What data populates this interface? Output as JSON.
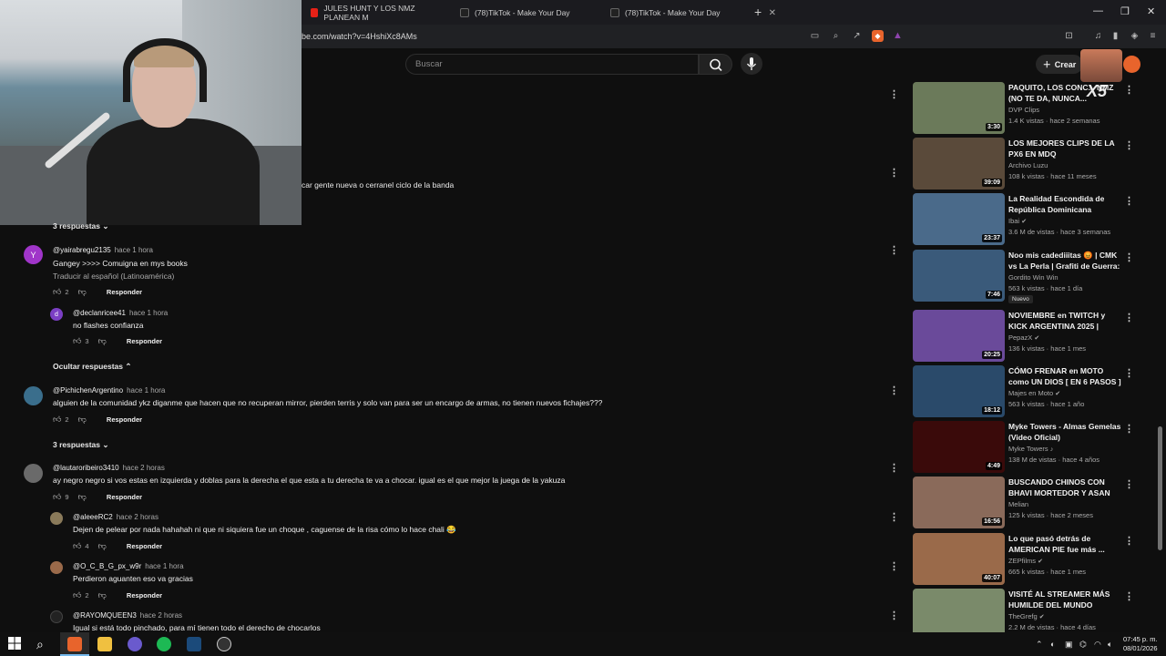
{
  "browser": {
    "tabs": [
      {
        "label": "JULES HUNT Y LOS NMZ PLANEAN M",
        "kind": "youtube"
      },
      {
        "label": "(78)TikTok - Make Your Day",
        "kind": "tiktok"
      },
      {
        "label": "(78)TikTok - Make Your Day",
        "kind": "tiktok"
      }
    ],
    "new_tab": "+",
    "url": "be.com/watch?v=4HshiXc8AMs"
  },
  "masthead": {
    "search_placeholder": "Buscar",
    "create_label": "Crear"
  },
  "overlay": {
    "multiplier": "X5"
  },
  "comments": {
    "partial_text": "car gente nueva o cerranel ciclo de la banda",
    "toggles": {
      "replies_1": "3 respuestas",
      "hide_replies": "Ocultar respuestas",
      "replies_2": "3 respuestas"
    },
    "reply_label": "Responder",
    "items": [
      {
        "user": "@yairabregu2135",
        "time": "hace 1 hora",
        "text": "Gangey >>>> Comuigna en mys books",
        "translate": "Traducir al español (Latinoamérica)",
        "likes": "2",
        "avatar_letter": "Y",
        "avatar_color": "#a035c9"
      },
      {
        "user": "@declanricee41",
        "time": "hace 1 hora",
        "text": "no flashes confianza",
        "likes": "3",
        "avatar_letter": "d",
        "avatar_color": "#7b3fc4"
      },
      {
        "user": "@PichichenArgentino",
        "time": "hace 1 hora",
        "text": "alguien de la comunidad ykz diganme que hacen que no recuperan mirror, pierden terris y solo van para ser un encargo de armas, no tienen nuevos fichajes???",
        "likes": "2",
        "avatar_letter": "",
        "avatar_color": "#3a6e8c"
      },
      {
        "user": "@lautaroribeiro3410",
        "time": "hace 2 horas",
        "text": "ay negro negro si vos estas en izquierda y doblas para la derecha el que esta a tu derecha te va a chocar. igual es el que mejor la juega de la yakuza",
        "likes": "9",
        "avatar_letter": "",
        "avatar_color": "#6a6a6a"
      },
      {
        "user": "@aleeeRC2",
        "time": "hace 2 horas",
        "text": "Dejen de pelear por nada hahahah ni que ni siquiera fue un choque , caguense de la risa cómo lo hace chali 😂",
        "likes": "4",
        "avatar_letter": "",
        "avatar_color": "#8a7a5a"
      },
      {
        "user": "@O_C_B_G_px_w9r",
        "time": "hace 1 hora",
        "text": "Perdieron aguanten eso va gracias",
        "likes": "2",
        "avatar_letter": "",
        "avatar_color": "#9a6a4a"
      },
      {
        "user": "@RAYOMQUEEN3",
        "time": "hace 2 horas",
        "text": "Igual si está todo pinchado, para mí tienen todo el derecho de chocarlos",
        "avatar_letter": "",
        "avatar_color": "#222222"
      }
    ]
  },
  "sidebar": {
    "videos": [
      {
        "title": "PAQUITO, LOS CONC... NMZ (NO TE DA, NUNCA...",
        "channel": "DVP Clips",
        "meta": "1.4 K vistas · hace 2 semanas",
        "duration": "3:30",
        "thumb": "#6b7a5a"
      },
      {
        "title": "LOS MEJORES CLIPS DE LA PX6 EN MDQ",
        "channel": "Archivo Luzu",
        "meta": "108 k vistas · hace 11 meses",
        "duration": "39:09",
        "thumb": "#5a4a3a"
      },
      {
        "title": "La Realidad Escondida de República Dominicana",
        "channel": "Ibai",
        "verified": "✔",
        "meta": "3.6 M de vistas · hace 3 semanas",
        "duration": "23:37",
        "thumb": "#4a6a8a"
      },
      {
        "title": "Noo mis cadediiitas 😡 | CMK vs La Perla | Grafiti de Guerra: ...",
        "channel": "Gordito Win Win",
        "meta": "563 k vistas · hace 1 día",
        "badge": "Nuevo",
        "duration": "7:46",
        "thumb": "#3a5a7a"
      },
      {
        "title": "NOVIEMBRE en TWITCH y KICK ARGENTINA 2025 | PepazX",
        "channel": "PepazX",
        "verified": "✔",
        "meta": "136 k vistas · hace 1 mes",
        "duration": "20:25",
        "thumb": "#6a4a9a"
      },
      {
        "title": "CÓMO FRENAR en MOTO como UN DIOS [ EN 6 PASOS ] ...",
        "channel": "Majes en Moto",
        "verified": "✔",
        "meta": "563 k vistas · hace 1 año",
        "duration": "18:12",
        "thumb": "#2a4a6a"
      },
      {
        "title": "Myke Towers - Almas Gemelas (Video Oficial)",
        "channel": "Myke Towers",
        "verified": "♪",
        "meta": "138 M de vistas · hace 4 años",
        "duration": "4:49",
        "thumb": "#3a0a0a"
      },
      {
        "title": "BUSCANDO CHINOS CON BHAVI MORTEDOR Y ASAN en...",
        "channel": "Melian",
        "meta": "125 k vistas · hace 2 meses",
        "duration": "16:56",
        "thumb": "#8a6a5a"
      },
      {
        "title": "Lo que pasó detrás de AMERICAN PIE fue más ...",
        "channel": "ZEPfilms",
        "verified": "✔",
        "meta": "665 k vistas · hace 1 mes",
        "duration": "40:07",
        "thumb": "#9a6a4a"
      },
      {
        "title": "VISITÉ AL STREAMER MÁS HUMILDE DEL MUNDO",
        "channel": "TheGrefg",
        "verified": "✔",
        "meta": "2.2 M de vistas · hace 4 días",
        "duration": "",
        "thumb": "#7a8a6a"
      }
    ]
  },
  "taskbar": {
    "time": "07:45 p. m.",
    "date": "08/01/2026"
  }
}
